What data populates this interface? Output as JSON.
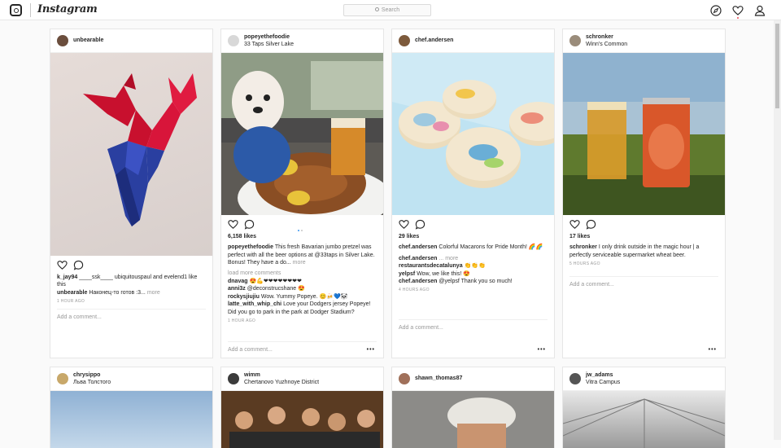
{
  "topbar": {
    "logo_text": "Instagram",
    "search_placeholder": "Search",
    "icons": [
      "compass-icon",
      "heart-icon",
      "user-icon"
    ]
  },
  "posts": [
    {
      "user": "unbearable",
      "location": "",
      "likes": "",
      "caption_user": "",
      "caption": "",
      "more": "",
      "comments": [
        {
          "user": "k_jay94",
          "text": "____ssk____ ubiquitouspaul and evelend1 like this"
        },
        {
          "user": "unbearable",
          "text": "Наконец-то готов :3...",
          "more": "more"
        }
      ],
      "time": "1 HOUR AGO",
      "add": "Add a comment..."
    },
    {
      "user": "popeyethefoodie",
      "location": "33 Taps Silver Lake",
      "likes": "6,158 likes",
      "caption_user": "popeyethefoodie",
      "caption": "This fresh Bavarian jumbo pretzel was perfect with all the beer options at @33taps in Silver Lake. Bonus! They have a do...",
      "more": "more",
      "load_more": "load more comments",
      "comments": [
        {
          "user": "dnavag",
          "text": "😍💪❤❤❤❤❤❤❤❤"
        },
        {
          "user": "anni3z",
          "text": "@deconstrucshane 😍"
        },
        {
          "user": "rockysjiujiu",
          "text": "Wow. Yummy Popeye. 😊🍻💙🐼"
        },
        {
          "user": "latte_with_whip_chi",
          "text": "Love your Dodgers jersey Popeye! Did you go to park in the park at Dodger Stadium?"
        }
      ],
      "time": "1 HOUR AGO",
      "add": "Add a comment..."
    },
    {
      "user": "chef.andersen",
      "location": "",
      "likes": "29 likes",
      "caption_user": "chef.andersen",
      "caption": "Colorful Macarons for Pride Month! 🌈🌈",
      "more": "",
      "comments": [
        {
          "user": "chef.andersen",
          "text": "...",
          "more": "more"
        },
        {
          "user": "restaurantsdecatalunya",
          "text": "👏👏👏"
        },
        {
          "user": "yelpsf",
          "text": "Wow, we like this! 😍"
        },
        {
          "user": "chef.andersen",
          "text": "@yelpsf Thank you so much!"
        }
      ],
      "time": "4 HOURS AGO",
      "add": "Add a comment..."
    },
    {
      "user": "schronker",
      "location": "Winn's Common",
      "likes": "17 likes",
      "caption_user": "schronker",
      "caption": "I only drink outside in the magic hour | a perfectly serviceable supermarket wheat beer.",
      "more": "",
      "comments": [],
      "time": "5 HOURS AGO",
      "add": "Add a comment..."
    },
    {
      "user": "chrysippo",
      "location": "Льва Толстого"
    },
    {
      "user": "wimm",
      "location": "Chertanovo Yuzhnoye District"
    },
    {
      "user": "shawn_thomas87",
      "location": ""
    },
    {
      "user": "jw_adams",
      "location": "Vitra Campus"
    }
  ],
  "colors": {
    "accent": "#3897f0",
    "like": "#ed4956",
    "border": "#e6e6e6",
    "bg": "#fafafa"
  }
}
